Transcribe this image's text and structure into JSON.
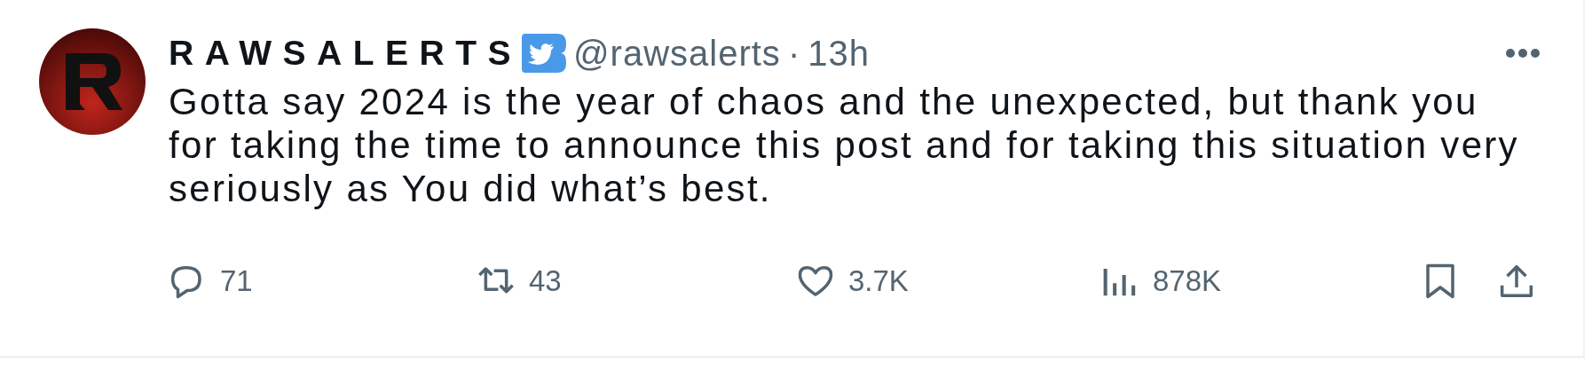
{
  "post": {
    "display_name": "RAWSALERTS",
    "verified": true,
    "handle": "@rawsalerts",
    "separator": "·",
    "time": "13h",
    "text": "Gotta say 2024 is the year of chaos and the unexpected, but thank you for taking the time to announce this post and for taking this situation very seriously as You did what’s best.",
    "actions": [
      {
        "kind": "reply",
        "count": "71"
      },
      {
        "kind": "repost",
        "count": "43"
      },
      {
        "kind": "like",
        "count": "3.7K"
      },
      {
        "kind": "views",
        "count": "878K"
      },
      {
        "kind": "bookmark"
      },
      {
        "kind": "share"
      }
    ]
  }
}
